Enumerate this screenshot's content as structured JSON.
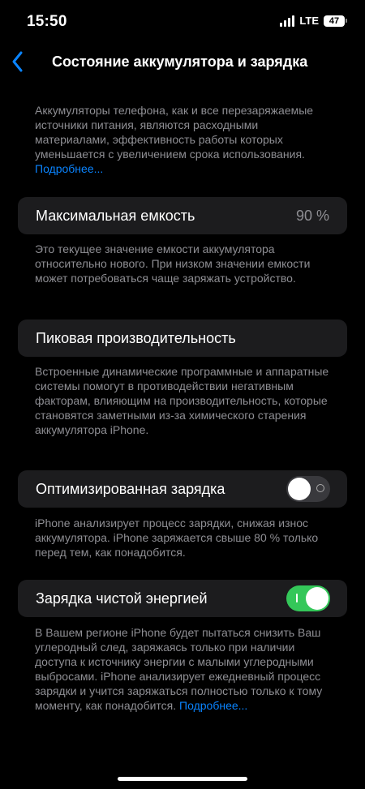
{
  "status_bar": {
    "time": "15:50",
    "network": "LTE",
    "battery": "47"
  },
  "nav": {
    "title": "Состояние аккумулятора и зарядка"
  },
  "intro": {
    "text": "Аккумуляторы телефона, как и все перезаряжаемые источники питания, являются расходными материалами, эффективность работы которых уменьшается с увеличением срока использования. ",
    "link": "Подробнее..."
  },
  "capacity": {
    "label": "Максимальная емкость",
    "value": "90 %",
    "description": "Это текущее значение емкости аккумулятора относительно нового. При низком значении емкости может потребоваться чаще заряжать устройство."
  },
  "peak": {
    "label": "Пиковая производительность",
    "description": "Встроенные динамические программные и аппаратные системы помогут в противодействии негативным факторам, влияющим на производительность, которые становятся заметными из-за химического старения аккумулятора iPhone."
  },
  "optimized": {
    "label": "Оптимизированная зарядка",
    "enabled": false,
    "description": "iPhone анализирует процесс зарядки, снижая износ аккумулятора. iPhone заряжается свыше 80 % только перед тем, как понадобится."
  },
  "clean": {
    "label": "Зарядка чистой энергией",
    "enabled": true,
    "description": "В Вашем регионе iPhone будет пытаться снизить Ваш углеродный след, заряжаясь только при наличии доступа к источнику энергии с малыми углеродными выбросами. iPhone анализирует ежедневный процесс зарядки и учится заряжаться полностью только к тому моменту, как понадобится. ",
    "link": "Подробнее..."
  },
  "colors": {
    "background": "#000000",
    "cell": "#1c1c1e",
    "secondary_text": "#8e8e93",
    "link": "#0a84ff",
    "toggle_on": "#34c759",
    "toggle_off": "#39393d"
  }
}
